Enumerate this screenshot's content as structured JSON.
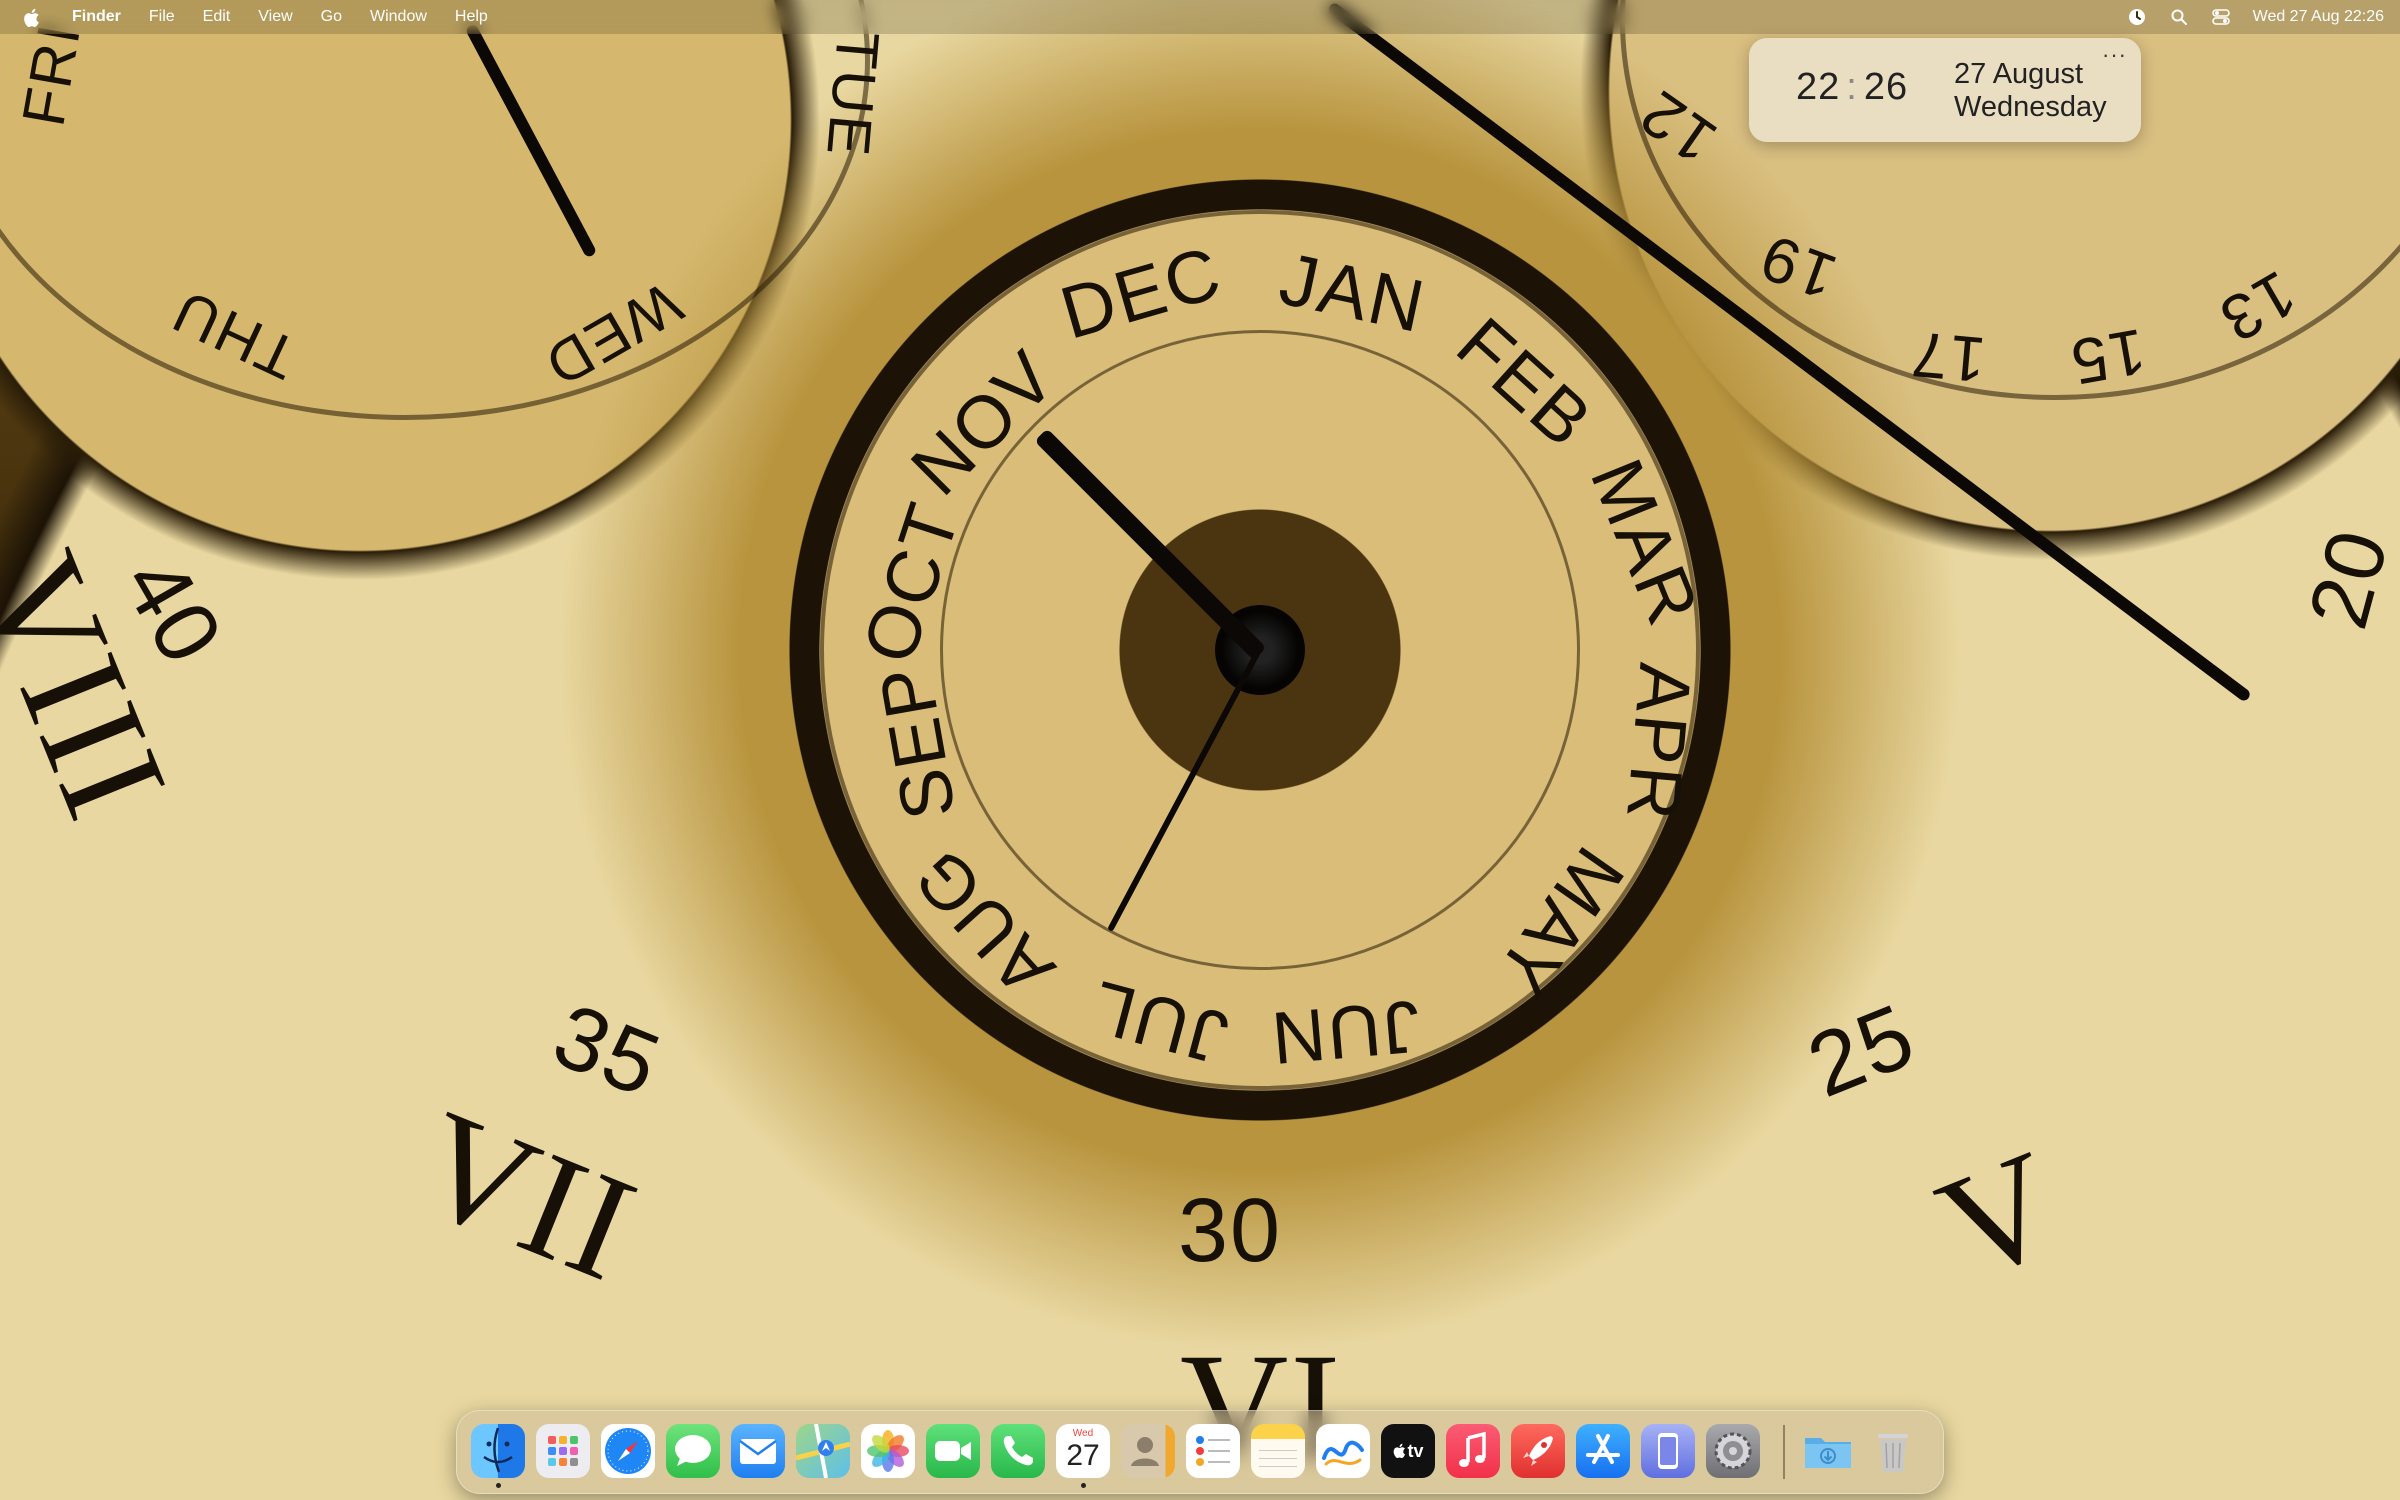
{
  "menubar": {
    "app_name": "Finder",
    "menus": [
      "File",
      "Edit",
      "View",
      "Go",
      "Window",
      "Help"
    ],
    "clock": "Wed 27 Aug  22:26"
  },
  "widget": {
    "hour": "22",
    "minute": "26",
    "date_line": "27 August",
    "weekday": "Wednesday",
    "menu_glyph": "···"
  },
  "wallpaper": {
    "months": [
      "SEP",
      "OCT",
      "NOV",
      "DEC",
      "JAN",
      "FEB",
      "MAR",
      "APR",
      "MAY",
      "JUN",
      "JUL",
      "AUG"
    ],
    "weekdays": [
      "FRI",
      "THU",
      "WED",
      "TUE"
    ],
    "dates": [
      "19",
      "17",
      "15",
      "13",
      "12",
      "20"
    ],
    "minutes": [
      "40",
      "35",
      "30",
      "25"
    ],
    "romans": [
      "VIII",
      "VII",
      "VI",
      "V"
    ]
  },
  "dock": {
    "apps": [
      {
        "name": "Finder",
        "icon": "finder-icon",
        "color": "#2f8cf0"
      },
      {
        "name": "Launchpad",
        "icon": "launchpad-icon",
        "color": "#e8e8ee"
      },
      {
        "name": "Safari",
        "icon": "safari-icon",
        "color": "#1e86f5"
      },
      {
        "name": "Messages",
        "icon": "messages-icon",
        "color": "#34c759"
      },
      {
        "name": "Mail",
        "icon": "mail-icon",
        "color": "#2e8ff5"
      },
      {
        "name": "Maps",
        "icon": "maps-icon",
        "color": "#59c06b"
      },
      {
        "name": "Photos",
        "icon": "photos-icon",
        "color": "#ffffff"
      },
      {
        "name": "FaceTime",
        "icon": "facetime-icon",
        "color": "#30c150"
      },
      {
        "name": "Phone",
        "icon": "phone-icon",
        "color": "#30c150"
      },
      {
        "name": "Calendar",
        "icon": "calendar-icon",
        "color": "#ffffff",
        "month": "Wed",
        "day": "27"
      },
      {
        "name": "Contacts",
        "icon": "contacts-icon",
        "color": "#d9cbb2"
      },
      {
        "name": "Reminders",
        "icon": "reminders-icon",
        "color": "#ffffff"
      },
      {
        "name": "Notes",
        "icon": "notes-icon",
        "color": "#fbd24a"
      },
      {
        "name": "Freeform",
        "icon": "freeform-icon",
        "color": "#ffffff"
      },
      {
        "name": "TV",
        "icon": "tv-icon",
        "color": "#111111",
        "label": "tv"
      },
      {
        "name": "Music",
        "icon": "music-icon",
        "color": "#fa3d52"
      },
      {
        "name": "Rocket",
        "icon": "rocket-icon",
        "color": "#f04a48"
      },
      {
        "name": "App Store",
        "icon": "app-store-icon",
        "color": "#1f8cf7"
      },
      {
        "name": "iPhone Mirroring",
        "icon": "iphone-mirroring-icon",
        "color": "#7a86e8"
      },
      {
        "name": "System Settings",
        "icon": "settings-icon",
        "color": "#8e8e93"
      },
      {
        "name": "Downloads",
        "icon": "downloads-folder-icon",
        "color": "#6ab8ec"
      },
      {
        "name": "Trash",
        "icon": "trash-icon",
        "color": "#c8c8cc"
      }
    ]
  }
}
